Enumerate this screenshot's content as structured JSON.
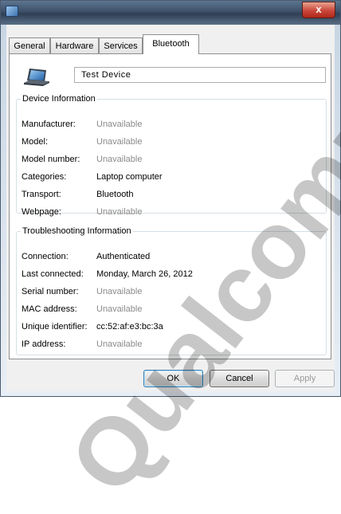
{
  "window": {
    "close_symbol": "x"
  },
  "tabs": [
    {
      "label": "General",
      "active": false
    },
    {
      "label": "Hardware",
      "active": false
    },
    {
      "label": "Services",
      "active": false
    },
    {
      "label": "Bluetooth",
      "active": true
    }
  ],
  "device": {
    "name": "Test Device",
    "icon": "laptop-icon"
  },
  "device_info": {
    "legend": "Device Information",
    "rows": [
      {
        "label": "Manufacturer:",
        "value": "Unavailable"
      },
      {
        "label": "Model:",
        "value": "Unavailable"
      },
      {
        "label": "Model number:",
        "value": "Unavailable"
      },
      {
        "label": "Categories:",
        "value": "Laptop computer"
      },
      {
        "label": "Transport:",
        "value": "Bluetooth"
      },
      {
        "label": "Webpage:",
        "value": "Unavailable"
      }
    ]
  },
  "troubleshooting": {
    "legend": "Troubleshooting Information",
    "rows": [
      {
        "label": "Connection:",
        "value": "Authenticated"
      },
      {
        "label": "Last connected:",
        "value": "Monday, March 26, 2012"
      },
      {
        "label": "Serial number:",
        "value": "Unavailable"
      },
      {
        "label": "MAC address:",
        "value": "Unavailable"
      },
      {
        "label": "Unique identifier:",
        "value": "cc:52:af:e3:bc:3a"
      },
      {
        "label": "IP address:",
        "value": "Unavailable"
      }
    ]
  },
  "buttons": {
    "ok": "OK",
    "cancel": "Cancel",
    "apply": "Apply"
  },
  "watermark": {
    "text": "Qualcomm At"
  }
}
